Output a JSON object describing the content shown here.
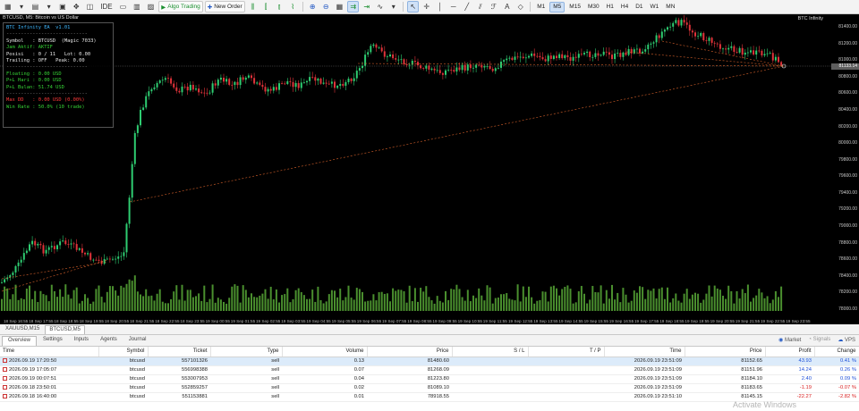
{
  "toolbar": {
    "ide_label": "IDE",
    "algo_label": "Algo Trading",
    "neworder_label": "New Order",
    "timeframes": [
      "M1",
      "M5",
      "M15",
      "M30",
      "H1",
      "H4",
      "D1",
      "W1",
      "MN"
    ],
    "active_timeframe": "M5"
  },
  "chart": {
    "title": "BTCUSD, M5: Bitcoin vs US Dollar",
    "ea_name": "BTC Infinity",
    "price_labels": [
      "81400.00",
      "81200.00",
      "81000.00",
      "80800.00",
      "80600.00",
      "80400.00",
      "80200.00",
      "80000.00",
      "79800.00",
      "79600.00",
      "79400.00",
      "79200.00",
      "79000.00",
      "78800.00",
      "78600.00",
      "78400.00",
      "78200.00",
      "78000.00"
    ],
    "current_price": "81133.14",
    "time_labels": [
      "18 Sep 16:55",
      "18 Sep 17:55",
      "18 Sep 18:55",
      "18 Sep 19:55",
      "18 Sep 20:55",
      "18 Sep 21:55",
      "18 Sep 22:55",
      "18 Sep 23:55",
      "19 Sep 00:55",
      "19 Sep 01:55",
      "19 Sep 02:55",
      "19 Sep 03:55",
      "19 Sep 04:55",
      "19 Sep 05:55",
      "19 Sep 06:55",
      "19 Sep 07:55",
      "19 Sep 08:55",
      "19 Sep 09:55",
      "19 Sep 10:55",
      "19 Sep 11:55",
      "19 Sep 12:55",
      "19 Sep 13:55",
      "19 Sep 14:55",
      "19 Sep 15:55",
      "19 Sep 16:55",
      "19 Sep 17:55",
      "19 Sep 18:55",
      "19 Sep 19:55",
      "19 Sep 20:55",
      "19 Sep 21:55",
      "19 Sep 22:55",
      "19 Sep 23:55"
    ],
    "up_color": "#2ecc71",
    "down_color": "#e0333a",
    "volume_color": "#4a8f2e"
  },
  "info_panel": {
    "lines": [
      {
        "text": "BTC Infinity EA  v1.01",
        "color": "cyan"
      },
      {
        "text": "----------------------------",
        "color": "gray"
      },
      {
        "text": "Symbol   : BTCUSD  (Magic 7033)",
        "color": "white"
      },
      {
        "text": "Jam Aktif: AKTIF",
        "color": "green"
      },
      {
        "text": "Posisi   : 0 / 11   Lot: 0.00",
        "color": "white"
      },
      {
        "text": "Trailing : OFF   Peak: 0.00",
        "color": "white"
      },
      {
        "text": "----------------------------",
        "color": "gray"
      },
      {
        "text": "Floating : 0.00 USD",
        "color": "green"
      },
      {
        "text": "P+L Hari : 0.00 USD",
        "color": "green"
      },
      {
        "text": "P+L Bulan: 51.74 USD",
        "color": "green"
      },
      {
        "text": "----------------------------",
        "color": "gray"
      },
      {
        "text": "Max DD   : 0.00 USD (0.00%)",
        "color": "red"
      },
      {
        "text": "Win Rate : 50.0% (10 trade)",
        "color": "green"
      }
    ]
  },
  "symbol_tabs": [
    "XAUUSD,M15",
    "BTCUSD,M5"
  ],
  "active_symbol_tab": 1,
  "toolbox": {
    "tabs": [
      "Overview",
      "Settings",
      "Inputs",
      "Agents",
      "Journal"
    ],
    "active_tab": 0,
    "right": {
      "market": "Market",
      "signals": "Signals",
      "vps": "VPS"
    },
    "columns": [
      "Time",
      "Symbol",
      "Ticket",
      "Type",
      "Volume",
      "Price",
      "S / L",
      "T / P",
      "Time",
      "Price",
      "Profit",
      "Change"
    ],
    "rows": [
      {
        "time": "2026.09.19 17:20:50",
        "symbol": "btcusd",
        "ticket": "557101326",
        "type": "sell",
        "volume": "0.13",
        "price": "81480.60",
        "sl": "",
        "tp": "",
        "time2": "2026.09.19 23:51:09",
        "price2": "81152.65",
        "profit": "43.93",
        "change": "0.41 %",
        "sign": "pos"
      },
      {
        "time": "2026.09.19 17:05:07",
        "symbol": "btcusd",
        "ticket": "556998388",
        "type": "sell",
        "volume": "0.07",
        "price": "81268.09",
        "sl": "",
        "tp": "",
        "time2": "2026.09.19 23:51:09",
        "price2": "81151.96",
        "profit": "14.24",
        "change": "0.26 %",
        "sign": "pos"
      },
      {
        "time": "2026.09.19 00:07:51",
        "symbol": "btcusd",
        "ticket": "553007953",
        "type": "sell",
        "volume": "0.04",
        "price": "81223.80",
        "sl": "",
        "tp": "",
        "time2": "2026.09.19 23:51:09",
        "price2": "81184.10",
        "profit": "2.40",
        "change": "0.09 %",
        "sign": "pos"
      },
      {
        "time": "2026.09.18 23:50:01",
        "symbol": "btcusd",
        "ticket": "552859257",
        "type": "sell",
        "volume": "0.02",
        "price": "81089.10",
        "sl": "",
        "tp": "",
        "time2": "2026.09.19 23:51:09",
        "price2": "81183.65",
        "profit": "-1.19",
        "change": "-0.07 %",
        "sign": "neg"
      },
      {
        "time": "2026.09.18 16:40:00",
        "symbol": "btcusd",
        "ticket": "551153881",
        "type": "sell",
        "volume": "0.01",
        "price": "78918.55",
        "sl": "",
        "tp": "",
        "time2": "2026.09.19 23:51:10",
        "price2": "81145.15",
        "profit": "-22.27",
        "change": "-2.82 %",
        "sign": "neg"
      }
    ]
  },
  "watermark": "Activate Windows"
}
